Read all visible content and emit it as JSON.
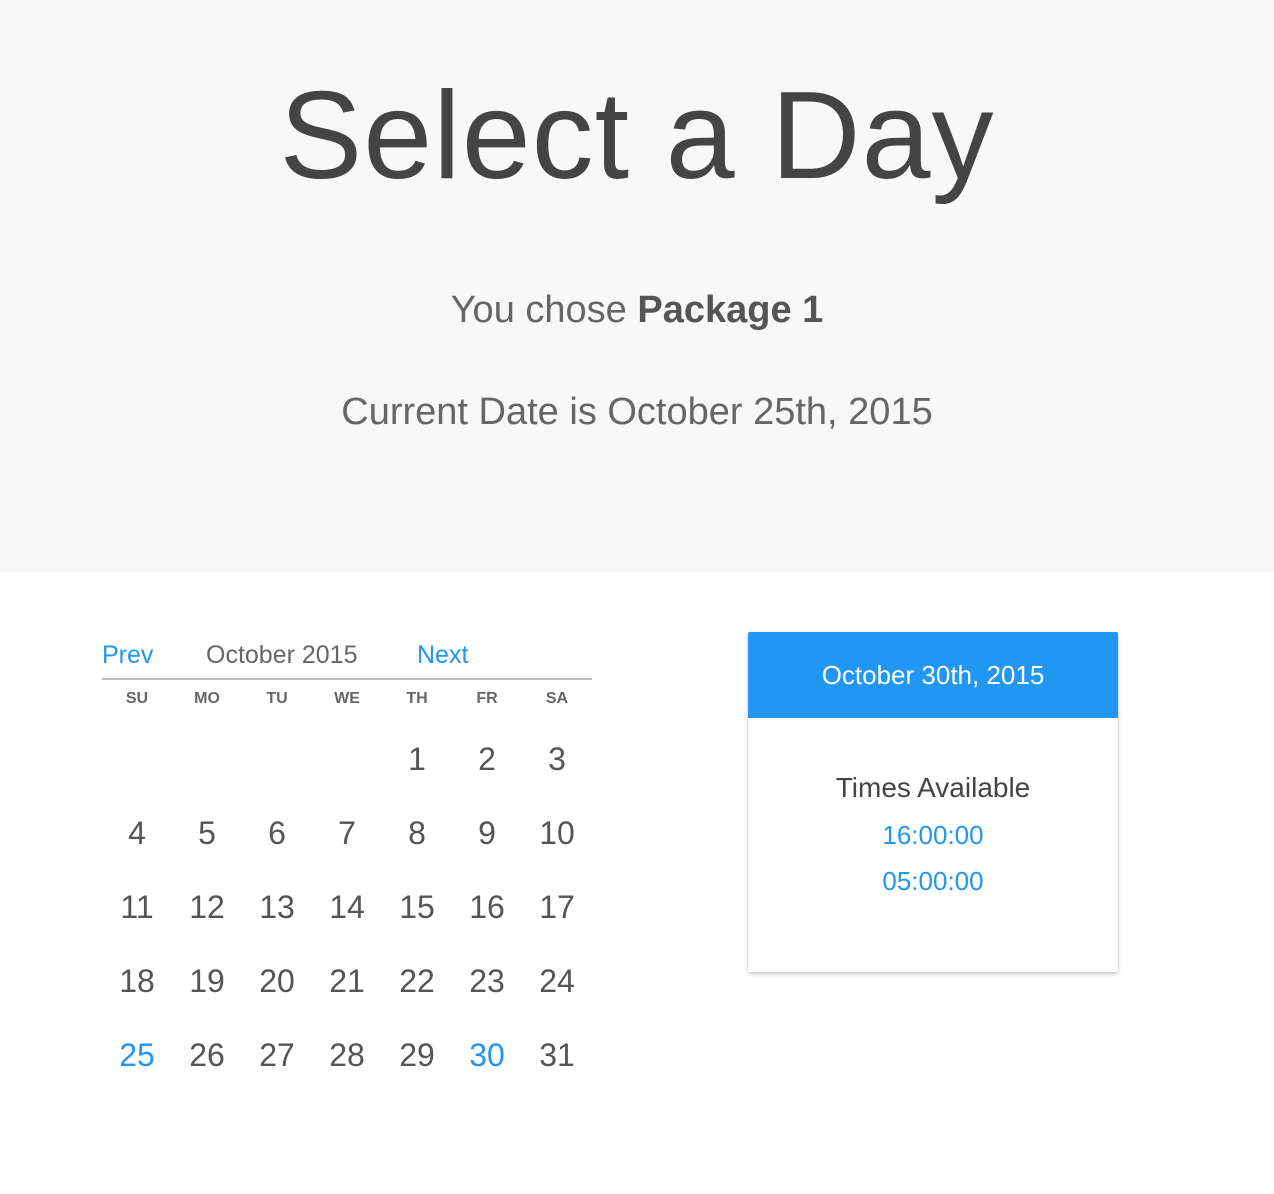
{
  "header": {
    "title": "Select a Day",
    "chose_prefix": "You chose",
    "package_name": "Package 1",
    "current_date": "Current Date is October 25th, 2015"
  },
  "calendar": {
    "prev_label": "Prev",
    "month_label": "October 2015",
    "next_label": "Next",
    "weekdays": [
      "SU",
      "MO",
      "TU",
      "WE",
      "TH",
      "FR",
      "SA"
    ],
    "weeks": [
      [
        "",
        "",
        "",
        "",
        "1",
        "2",
        "3"
      ],
      [
        "4",
        "5",
        "6",
        "7",
        "8",
        "9",
        "10"
      ],
      [
        "11",
        "12",
        "13",
        "14",
        "15",
        "16",
        "17"
      ],
      [
        "18",
        "19",
        "20",
        "21",
        "22",
        "23",
        "24"
      ],
      [
        "25",
        "26",
        "27",
        "28",
        "29",
        "30",
        "31"
      ]
    ],
    "today": "25",
    "selected": "30"
  },
  "panel": {
    "date": "October 30th, 2015",
    "subtitle": "Times Available",
    "times": [
      "16:00:00",
      "05:00:00"
    ]
  },
  "colors": {
    "accent": "#2196f3",
    "hero_bg": "#f8f8f8"
  }
}
